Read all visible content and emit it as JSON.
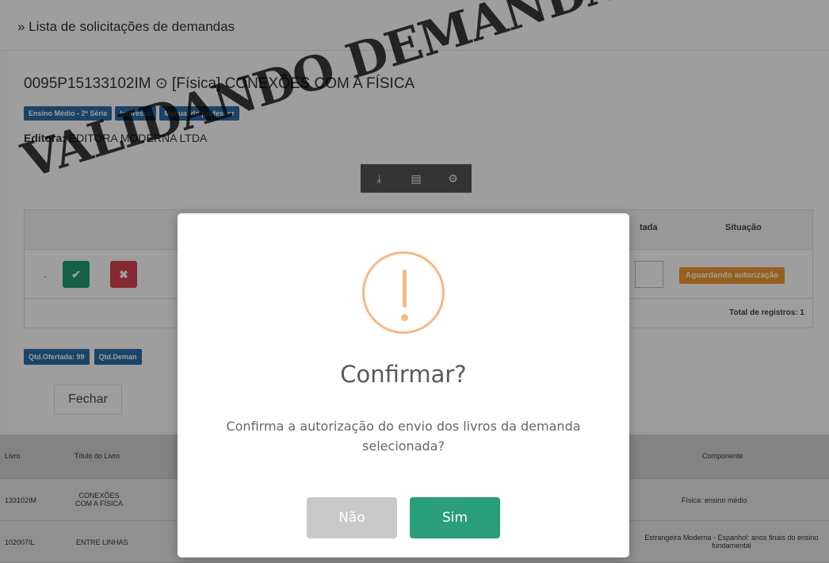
{
  "page": {
    "header_title": "» Lista de solicitações de demandas",
    "code_title": "0095P15133102IM ⊙ [Física] CONEXÕES COM A FÍSICA",
    "badges": [
      "Ensino Médio - 2ª Série",
      "Impresso",
      "Manual do professor"
    ],
    "editora_label": "Editora:",
    "editora_value": "EDITORA MODERNA LTDA",
    "toolbar_icons": [
      "download-icon",
      "file-icon",
      "gear-icon"
    ],
    "table": {
      "header_ofertada": "tada",
      "header_situacao": "Situação",
      "row_dash": "-",
      "status": "Aguardando autorização",
      "total": "Total de registros: 1",
      "accept_icon": "✔",
      "reject_icon": "✖"
    },
    "qtd_badges": [
      "Qtd.Ofertada: 99",
      "Qtd.Deman"
    ],
    "close_label": "Fechar",
    "lower_table": {
      "headers": [
        "Livro",
        "Título do Livro",
        "Componente"
      ],
      "rows": [
        [
          "133102IM",
          "CONEXÕES COM A FÍSICA",
          "Física: ensino médio"
        ],
        [
          "102007IL",
          "ENTRE LINHAS",
          "Estrangeira Moderna - Espanhol: anos finais do ensino fundamental"
        ]
      ]
    }
  },
  "watermark": "VALIDANDO DEMANDA",
  "modal": {
    "icon": "warning-icon",
    "title": "Confirmar?",
    "text": "Confirma a autorização do envio dos livros da demanda selecionada?",
    "cancel_label": "Não",
    "confirm_label": "Sim",
    "colors": {
      "warning": "#f5b987",
      "confirm": "#2a9d7a",
      "cancel": "#c9c9c9"
    }
  }
}
